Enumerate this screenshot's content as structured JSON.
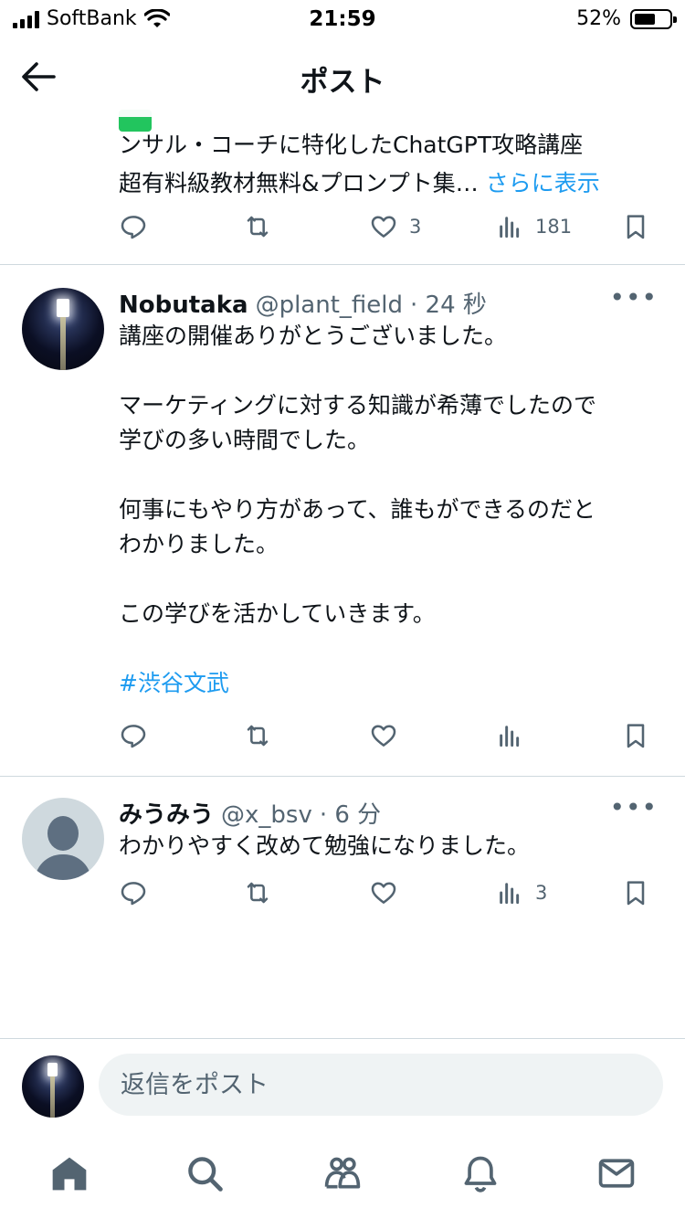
{
  "status_bar": {
    "carrier": "SoftBank",
    "time": "21:59",
    "battery": "52%",
    "battery_level": 0.52
  },
  "header": {
    "title": "ポスト"
  },
  "partial_post": {
    "line1": "ンサル・コーチに特化したChatGPT攻略講座",
    "line2": "超有料級教材無料&プロンプト集…",
    "more_label": "さらに表示",
    "likes": "3",
    "views": "181"
  },
  "replies": [
    {
      "name": "Nobutaka",
      "handle": "@plant_field",
      "time": "· 24 秒",
      "paragraphs": [
        "講座の開催ありがとうございました。",
        "",
        "マーケティングに対する知識が希薄でしたので",
        "学びの多い時間でした。",
        "",
        "何事にもやり方があって、誰もができるのだと",
        "わかりました。",
        "",
        "この学びを活かしていきます。",
        ""
      ],
      "hashtag": "#渋谷文武"
    },
    {
      "name": "みうみう",
      "handle": "@x_bsv",
      "time": "· 6 分",
      "text": "わかりやすく改めて勉強になりました。",
      "views": "3"
    }
  ],
  "reply_bar": {
    "placeholder": "返信をポスト"
  },
  "tabbar": {
    "items": [
      "home-icon",
      "search-icon",
      "communities-icon",
      "notifications-icon",
      "messages-icon"
    ]
  },
  "colors": {
    "accent": "#1d9bf0",
    "muted": "#536471",
    "divider": "#cfd9de"
  }
}
